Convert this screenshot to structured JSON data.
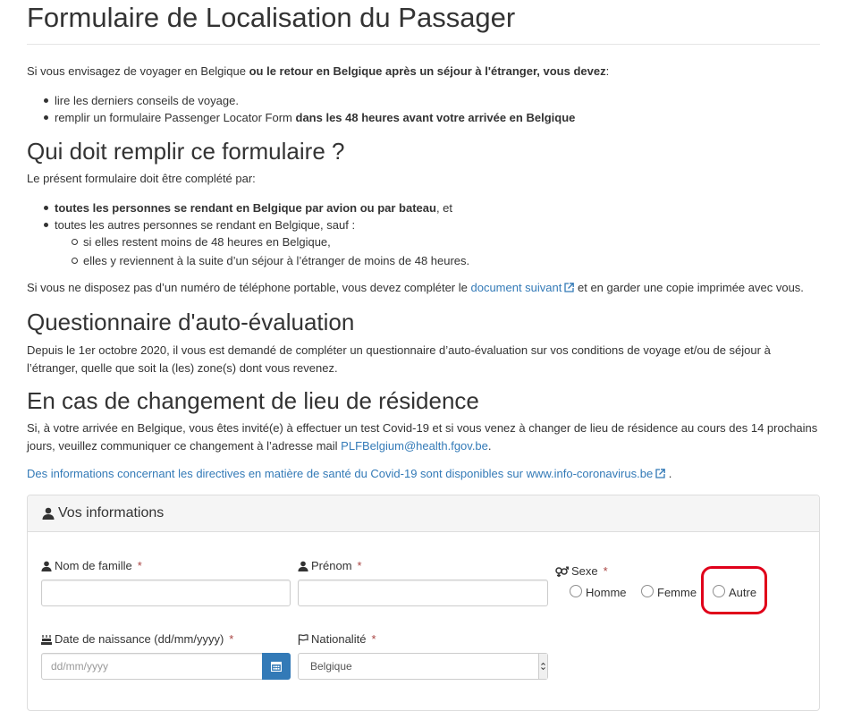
{
  "title": "Formulaire de Localisation du Passager",
  "intro": {
    "text_a": "Si vous envisagez de voyager en Belgique ",
    "bold": "ou le retour en Belgique après un séjour à l'étranger, vous devez",
    "text_b": ":",
    "bullets": [
      {
        "text": "lire les derniers conseils de voyage.",
        "bold": ""
      },
      {
        "text": "remplir un formulaire Passenger Locator Form ",
        "bold": "dans les 48 heures avant votre arrivée en Belgique"
      }
    ]
  },
  "who": {
    "heading": "Qui doit remplir ce formulaire ?",
    "lead": "Le présent formulaire doit être complété par:",
    "bullet1_bold": "toutes les personnes se rendant en Belgique par avion ou par bateau",
    "bullet1_rest": ", et",
    "bullet2": "toutes les autres personnes se rendant en Belgique, sauf :",
    "sub_bullets": [
      "si elles restent moins de 48 heures en Belgique,",
      "elles y reviennent à la suite d’un séjour à l’étranger de moins de 48 heures."
    ],
    "phone_text_a": "Si vous ne disposez pas d’un numéro de téléphone portable, vous devez compléter le ",
    "phone_link": "document suivant",
    "phone_text_b": " et en garder une copie imprimée avec vous."
  },
  "self_eval": {
    "heading": "Questionnaire d'auto-évaluation",
    "text": "Depuis le 1er octobre 2020, il vous est demandé de compléter un questionnaire d’auto-évaluation sur vos conditions de voyage et/ou de séjour à l’étranger, quelle que soit la (les) zone(s) dont vous revenez."
  },
  "residence": {
    "heading": "En cas de changement de lieu de résidence",
    "text": "Si, à votre arrivée en Belgique, vous êtes invité(e) à effectuer un test Covid-19 et si vous venez à changer de lieu de résidence au cours des 14 prochains jours, veuillez communiquer ce changement à l’adresse mail ",
    "email": "PLFBelgium@health.fgov.be",
    "text_end": ".",
    "info_link": "Des informations concernant les directives en matière de santé du Covid-19 sont disponibles sur www.info-coronavirus.be",
    "info_end": " ."
  },
  "form": {
    "panel_title": "Vos informations",
    "last_name_label": "Nom de famille",
    "last_name_value": "",
    "first_name_label": "Prénom",
    "first_name_value": "",
    "sex_label": "Sexe",
    "sex_options": [
      "Homme",
      "Femme",
      "Autre"
    ],
    "birth_label": "Date de naissance (dd/mm/yyyy)",
    "birth_placeholder": "dd/mm/yyyy",
    "nationality_label": "Nationalité",
    "nationality_value": "Belgique",
    "required_mark": "*"
  },
  "colors": {
    "link": "#337ab7",
    "required": "#a94442",
    "highlight": "#e0001a"
  }
}
